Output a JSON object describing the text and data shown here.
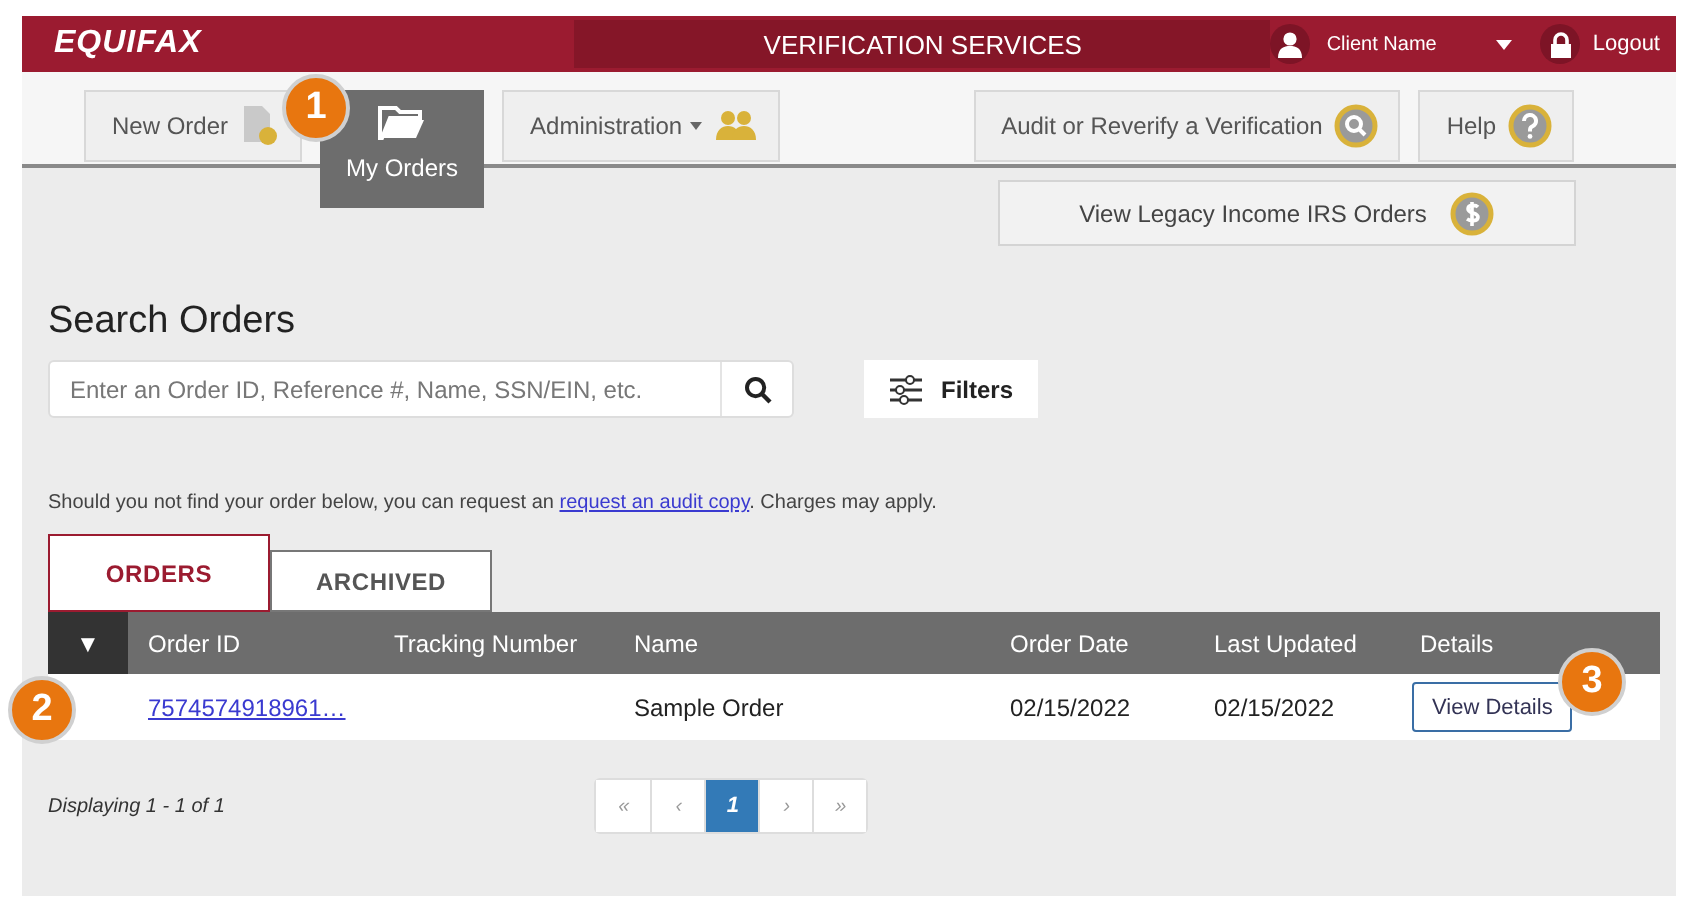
{
  "header": {
    "logo": "EQUIFAX",
    "title": "VERIFICATION SERVICES",
    "user": "Client Name",
    "logout": "Logout"
  },
  "nav_left": [
    {
      "label": "New Order",
      "kind": "document",
      "selected": false
    },
    {
      "label": "My Orders",
      "kind": "folder",
      "selected": true,
      "callout": "1"
    },
    {
      "label": "Administration",
      "kind": "people",
      "selected": false,
      "dropdown": true
    }
  ],
  "nav_right": [
    {
      "label": "Audit or Reverify a Verification",
      "kind": "search",
      "selected": false
    },
    {
      "label": "Help",
      "kind": "help",
      "selected": false
    }
  ],
  "legacy_button": {
    "label": "View Legacy Income IRS Orders",
    "kind": "dollar"
  },
  "search": {
    "title": "Search Orders",
    "placeholder": "Enter an Order ID, Reference #, Name, SSN/EIN, etc.",
    "filters": "Filters"
  },
  "note": {
    "before": "Should you not find your order below, you can request an ",
    "link": "request an audit copy",
    "after": ". Charges may apply."
  },
  "tabs": [
    {
      "label": "ORDERS",
      "selected": true
    },
    {
      "label": "ARCHIVED",
      "selected": false
    }
  ],
  "table": {
    "columns": [
      "▼",
      "Order ID",
      "Tracking Number",
      "Name",
      "Order Date",
      "Last Updated",
      "Details"
    ],
    "rows": [
      {
        "order_id": "7574574918961…",
        "name": "Sample Order",
        "order_date": "02/15/2022",
        "last_updated": "02/15/2022",
        "details": "View Details",
        "id_callout": "2",
        "details_callout": "3"
      }
    ]
  },
  "footer": {
    "displaying": "Displaying 1 - 1 of 1"
  },
  "pagination": [
    {
      "label": "«",
      "selected": false
    },
    {
      "label": "‹",
      "selected": false
    },
    {
      "label": "1",
      "selected": true
    },
    {
      "label": "›",
      "selected": false
    },
    {
      "label": "»",
      "selected": false
    }
  ]
}
